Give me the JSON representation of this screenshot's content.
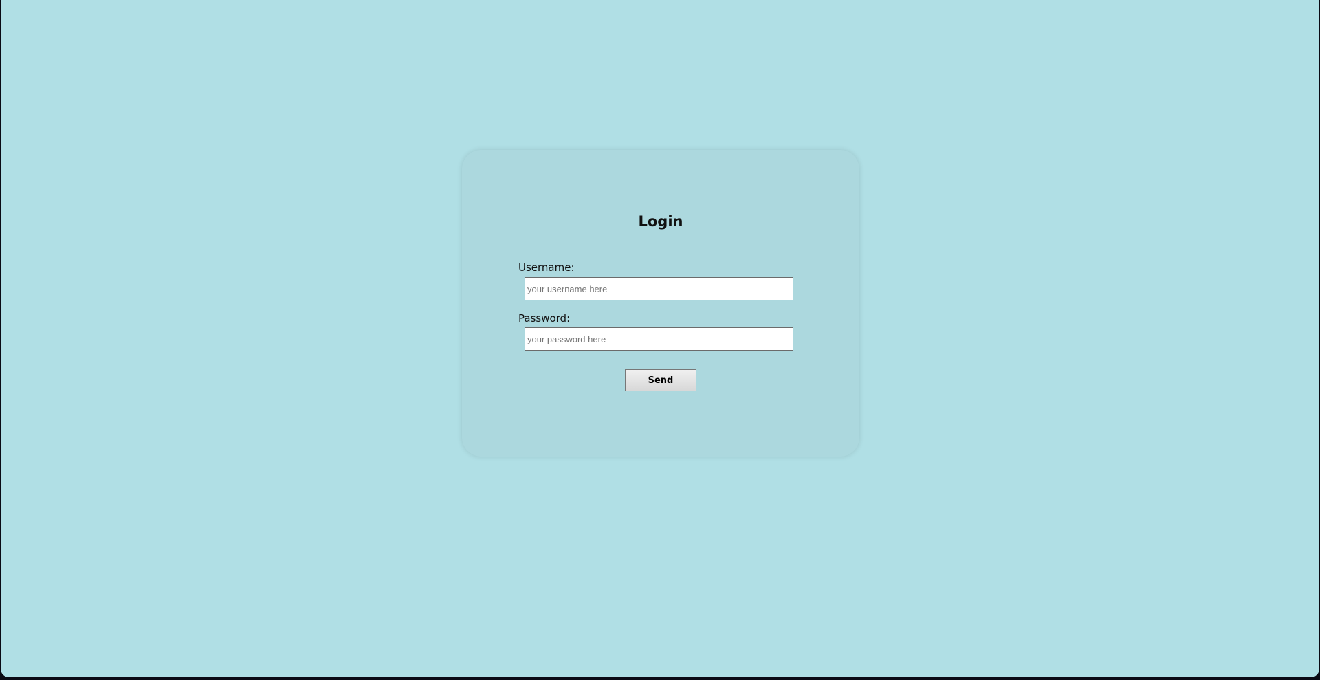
{
  "login": {
    "title": "Login",
    "username_label": "Username:",
    "username_placeholder": "your username here",
    "username_value": "",
    "password_label": "Password:",
    "password_placeholder": "your password here",
    "password_value": "",
    "send_label": "Send"
  },
  "colors": {
    "background": "#b0dfe5",
    "card": "#acd8de"
  }
}
